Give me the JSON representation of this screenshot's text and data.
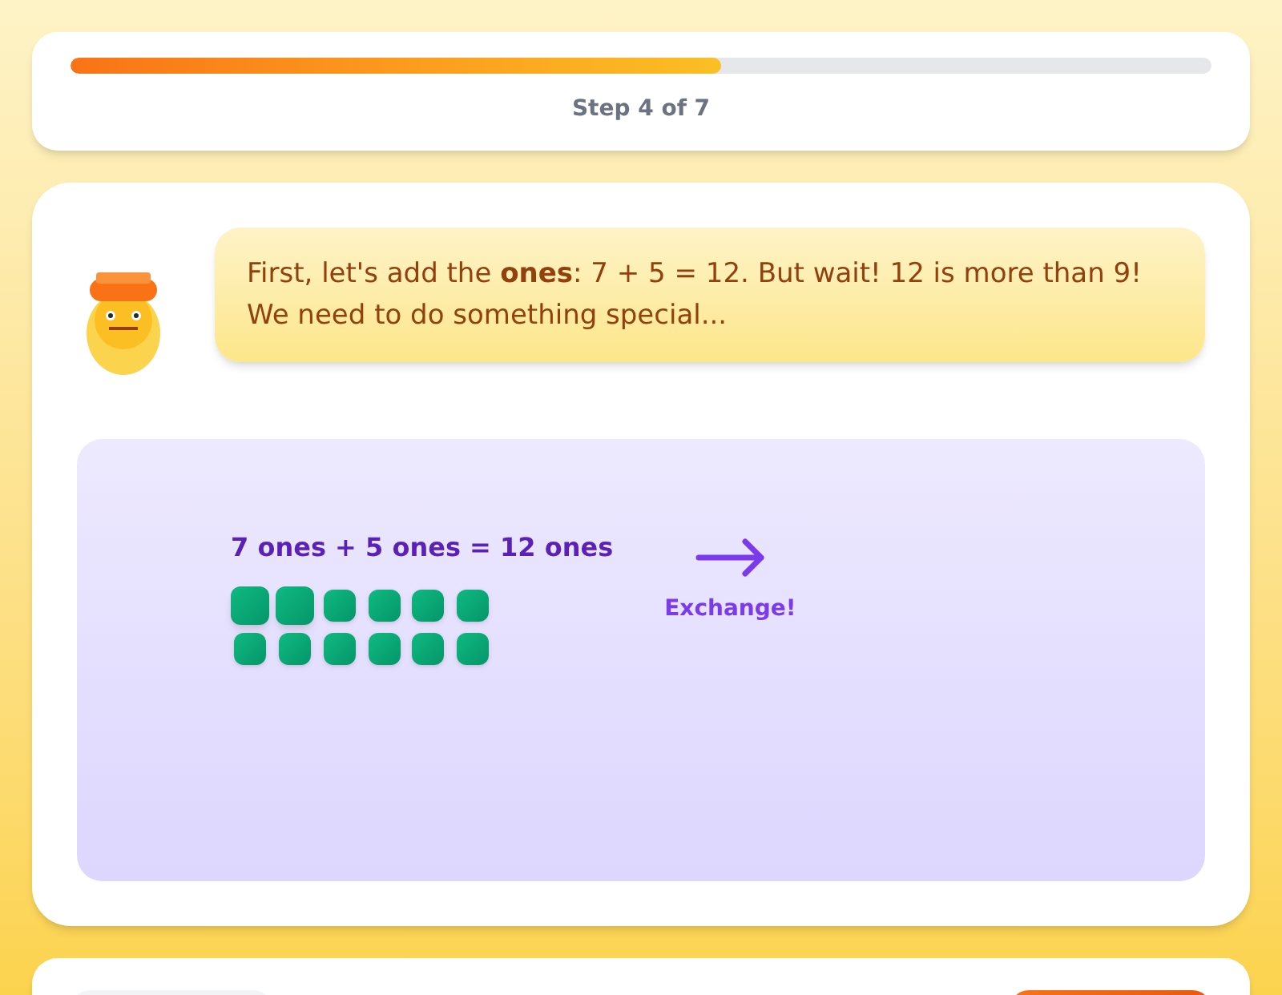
{
  "progress": {
    "level": 0.57,
    "label": "Step 4 of 7"
  },
  "tutor": {
    "message": "First, let's add the **ones**: 7 + 5 = 12. But wait! 12 is more than 9! We need to do something special..."
  },
  "workspace": {
    "equation": "7 ones + 5 ones = 12 ones",
    "blocks": [
      {
        "highlighted": true
      },
      {
        "highlighted": true
      },
      {
        "highlighted": false
      },
      {
        "highlighted": false
      },
      {
        "highlighted": false
      },
      {
        "highlighted": false
      },
      {
        "highlighted": false
      },
      {
        "highlighted": false
      },
      {
        "highlighted": false
      },
      {
        "highlighted": false
      },
      {
        "highlighted": false
      },
      {
        "highlighted": false
      }
    ],
    "action": "Exchange!"
  }
}
